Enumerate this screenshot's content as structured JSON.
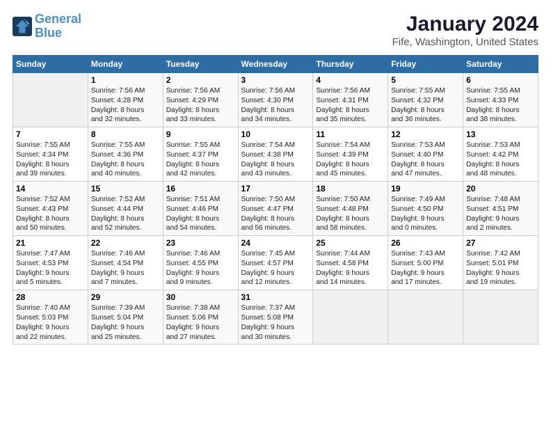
{
  "header": {
    "logo_line1": "General",
    "logo_line2": "Blue",
    "title": "January 2024",
    "subtitle": "Fife, Washington, United States"
  },
  "weekdays": [
    "Sunday",
    "Monday",
    "Tuesday",
    "Wednesday",
    "Thursday",
    "Friday",
    "Saturday"
  ],
  "weeks": [
    [
      {
        "day": "",
        "info": ""
      },
      {
        "day": "1",
        "info": "Sunrise: 7:56 AM\nSunset: 4:28 PM\nDaylight: 8 hours\nand 32 minutes."
      },
      {
        "day": "2",
        "info": "Sunrise: 7:56 AM\nSunset: 4:29 PM\nDaylight: 8 hours\nand 33 minutes."
      },
      {
        "day": "3",
        "info": "Sunrise: 7:56 AM\nSunset: 4:30 PM\nDaylight: 8 hours\nand 34 minutes."
      },
      {
        "day": "4",
        "info": "Sunrise: 7:56 AM\nSunset: 4:31 PM\nDaylight: 8 hours\nand 35 minutes."
      },
      {
        "day": "5",
        "info": "Sunrise: 7:55 AM\nSunset: 4:32 PM\nDaylight: 8 hours\nand 36 minutes."
      },
      {
        "day": "6",
        "info": "Sunrise: 7:55 AM\nSunset: 4:33 PM\nDaylight: 8 hours\nand 38 minutes."
      }
    ],
    [
      {
        "day": "7",
        "info": "Sunrise: 7:55 AM\nSunset: 4:34 PM\nDaylight: 8 hours\nand 39 minutes."
      },
      {
        "day": "8",
        "info": "Sunrise: 7:55 AM\nSunset: 4:36 PM\nDaylight: 8 hours\nand 40 minutes."
      },
      {
        "day": "9",
        "info": "Sunrise: 7:55 AM\nSunset: 4:37 PM\nDaylight: 8 hours\nand 42 minutes."
      },
      {
        "day": "10",
        "info": "Sunrise: 7:54 AM\nSunset: 4:38 PM\nDaylight: 8 hours\nand 43 minutes."
      },
      {
        "day": "11",
        "info": "Sunrise: 7:54 AM\nSunset: 4:39 PM\nDaylight: 8 hours\nand 45 minutes."
      },
      {
        "day": "12",
        "info": "Sunrise: 7:53 AM\nSunset: 4:40 PM\nDaylight: 8 hours\nand 47 minutes."
      },
      {
        "day": "13",
        "info": "Sunrise: 7:53 AM\nSunset: 4:42 PM\nDaylight: 8 hours\nand 48 minutes."
      }
    ],
    [
      {
        "day": "14",
        "info": "Sunrise: 7:52 AM\nSunset: 4:43 PM\nDaylight: 8 hours\nand 50 minutes."
      },
      {
        "day": "15",
        "info": "Sunrise: 7:52 AM\nSunset: 4:44 PM\nDaylight: 8 hours\nand 52 minutes."
      },
      {
        "day": "16",
        "info": "Sunrise: 7:51 AM\nSunset: 4:46 PM\nDaylight: 8 hours\nand 54 minutes."
      },
      {
        "day": "17",
        "info": "Sunrise: 7:50 AM\nSunset: 4:47 PM\nDaylight: 8 hours\nand 56 minutes."
      },
      {
        "day": "18",
        "info": "Sunrise: 7:50 AM\nSunset: 4:48 PM\nDaylight: 8 hours\nand 58 minutes."
      },
      {
        "day": "19",
        "info": "Sunrise: 7:49 AM\nSunset: 4:50 PM\nDaylight: 9 hours\nand 0 minutes."
      },
      {
        "day": "20",
        "info": "Sunrise: 7:48 AM\nSunset: 4:51 PM\nDaylight: 9 hours\nand 2 minutes."
      }
    ],
    [
      {
        "day": "21",
        "info": "Sunrise: 7:47 AM\nSunset: 4:53 PM\nDaylight: 9 hours\nand 5 minutes."
      },
      {
        "day": "22",
        "info": "Sunrise: 7:46 AM\nSunset: 4:54 PM\nDaylight: 9 hours\nand 7 minutes."
      },
      {
        "day": "23",
        "info": "Sunrise: 7:46 AM\nSunset: 4:55 PM\nDaylight: 9 hours\nand 9 minutes."
      },
      {
        "day": "24",
        "info": "Sunrise: 7:45 AM\nSunset: 4:57 PM\nDaylight: 9 hours\nand 12 minutes."
      },
      {
        "day": "25",
        "info": "Sunrise: 7:44 AM\nSunset: 4:58 PM\nDaylight: 9 hours\nand 14 minutes."
      },
      {
        "day": "26",
        "info": "Sunrise: 7:43 AM\nSunset: 5:00 PM\nDaylight: 9 hours\nand 17 minutes."
      },
      {
        "day": "27",
        "info": "Sunrise: 7:42 AM\nSunset: 5:01 PM\nDaylight: 9 hours\nand 19 minutes."
      }
    ],
    [
      {
        "day": "28",
        "info": "Sunrise: 7:40 AM\nSunset: 5:03 PM\nDaylight: 9 hours\nand 22 minutes."
      },
      {
        "day": "29",
        "info": "Sunrise: 7:39 AM\nSunset: 5:04 PM\nDaylight: 9 hours\nand 25 minutes."
      },
      {
        "day": "30",
        "info": "Sunrise: 7:38 AM\nSunset: 5:06 PM\nDaylight: 9 hours\nand 27 minutes."
      },
      {
        "day": "31",
        "info": "Sunrise: 7:37 AM\nSunset: 5:08 PM\nDaylight: 9 hours\nand 30 minutes."
      },
      {
        "day": "",
        "info": ""
      },
      {
        "day": "",
        "info": ""
      },
      {
        "day": "",
        "info": ""
      }
    ]
  ]
}
